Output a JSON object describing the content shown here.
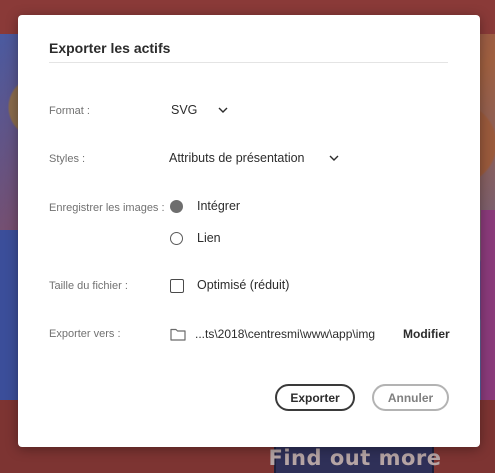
{
  "dialog": {
    "title": "Exporter les actifs",
    "format": {
      "label": "Format :",
      "value": "SVG"
    },
    "styles": {
      "label": "Styles :",
      "value": "Attributs de présentation"
    },
    "images": {
      "label": "Enregistrer les images :",
      "options": [
        {
          "label": "Intégrer",
          "selected": true
        },
        {
          "label": "Lien",
          "selected": false
        }
      ]
    },
    "filesize": {
      "label": "Taille du fichier :",
      "option_label": "Optimisé (réduit)",
      "checked": false
    },
    "export_to": {
      "label": "Exporter vers :",
      "path": "...ts\\2018\\centresmi\\www\\app\\img",
      "modify_label": "Modifier"
    },
    "buttons": {
      "export": "Exporter",
      "cancel": "Annuler"
    }
  },
  "background": {
    "cta_text": "Find out more"
  },
  "icons": {
    "format_dropdown": "chevron-down-icon",
    "styles_dropdown": "chevron-down-icon",
    "folder": "folder-icon"
  },
  "colors": {
    "overlay": "#7a3333",
    "dialog_bg": "#ffffff",
    "text": "#2c2c2c",
    "label": "#717171"
  }
}
